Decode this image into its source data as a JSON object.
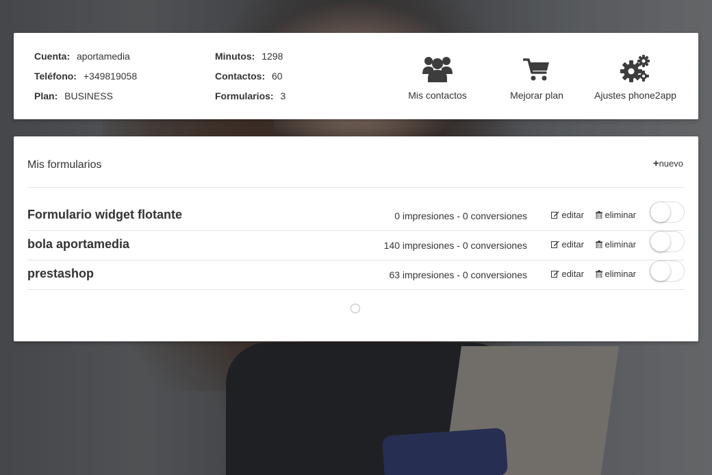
{
  "account": {
    "items_left": [
      {
        "label": "Cuenta:",
        "value": "aportamedia"
      },
      {
        "label": "Teléfono:",
        "value": "+349819058"
      },
      {
        "label": "Plan:",
        "value": "BUSINESS"
      }
    ],
    "items_right": [
      {
        "label": "Minutos:",
        "value": "1298"
      },
      {
        "label": "Contactos:",
        "value": "60"
      },
      {
        "label": "Formularios:",
        "value": "3"
      }
    ]
  },
  "actions": [
    {
      "label": "Mis contactos",
      "icon": "users-icon"
    },
    {
      "label": "Mejorar plan",
      "icon": "cart-icon"
    },
    {
      "label": "Ajustes phone2app",
      "icon": "gears-icon"
    }
  ],
  "forms": {
    "title": "Mis formularios",
    "new_label": "nuevo",
    "edit_label": "editar",
    "delete_label": "eliminar",
    "rows": [
      {
        "name": "Formulario widget flotante",
        "stats": "0 impresiones - 0 conversiones",
        "enabled": false
      },
      {
        "name": "bola aportamedia",
        "stats": "140 impresiones - 0 conversiones",
        "enabled": false
      },
      {
        "name": "prestashop",
        "stats": "63 impresiones - 0 conversiones",
        "enabled": false
      }
    ]
  },
  "colors": {
    "text": "#333333",
    "card": "#ffffff",
    "divider": "#e6e6e6"
  }
}
